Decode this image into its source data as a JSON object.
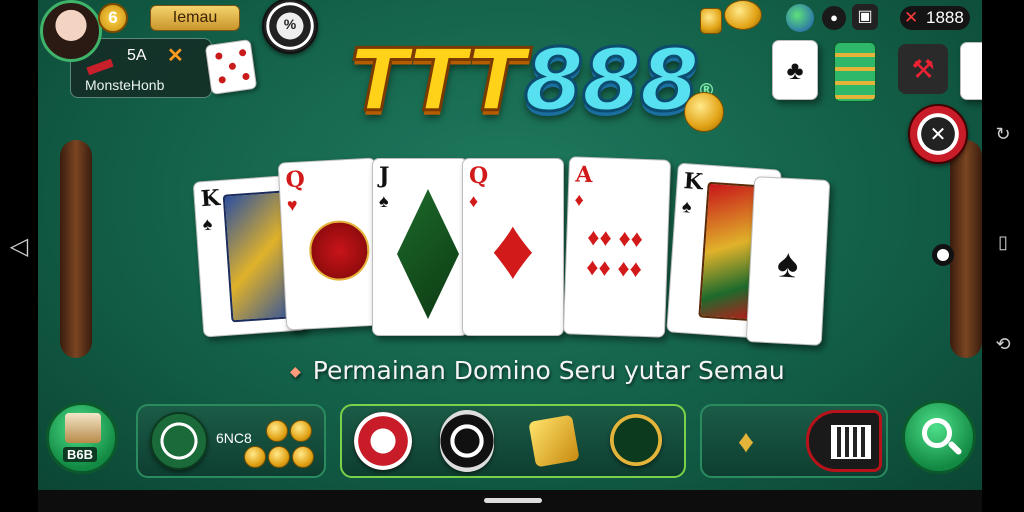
{
  "player": {
    "level": "6",
    "name_tag": "Iemau",
    "stat_value": "5A",
    "stat_mark": "✕",
    "username": "MonsteHonb"
  },
  "top_right": {
    "coin_count": "1888"
  },
  "logo": {
    "letters": "TTT",
    "digits": "888",
    "registered": "®"
  },
  "hand": [
    {
      "rank": "K",
      "suit": "♠",
      "color": "black"
    },
    {
      "rank": "Q",
      "suit": "♥",
      "color": "red"
    },
    {
      "rank": "J",
      "suit": "♠",
      "color": "black"
    },
    {
      "rank": "Q",
      "suit": "♦",
      "color": "red"
    },
    {
      "rank": "A",
      "suit": "♦",
      "color": "red"
    },
    {
      "rank": "K",
      "suit": "♠",
      "color": "black"
    },
    {
      "rank": "",
      "suit": "♠",
      "color": "black"
    }
  ],
  "tagline": "Permainan Domino Seru yutar Semau",
  "bottom": {
    "left_badge": "B6B",
    "chip_panel_text": "6NC8"
  },
  "colors": {
    "felt": "#136048",
    "accent_green": "#2a8a60",
    "logo_gold": "#ffd21a",
    "logo_cyan": "#56e0f0"
  },
  "icons": {
    "search": "search-icon",
    "back": "back-icon",
    "home": "home-pill",
    "qr": "qr-code-icon"
  }
}
